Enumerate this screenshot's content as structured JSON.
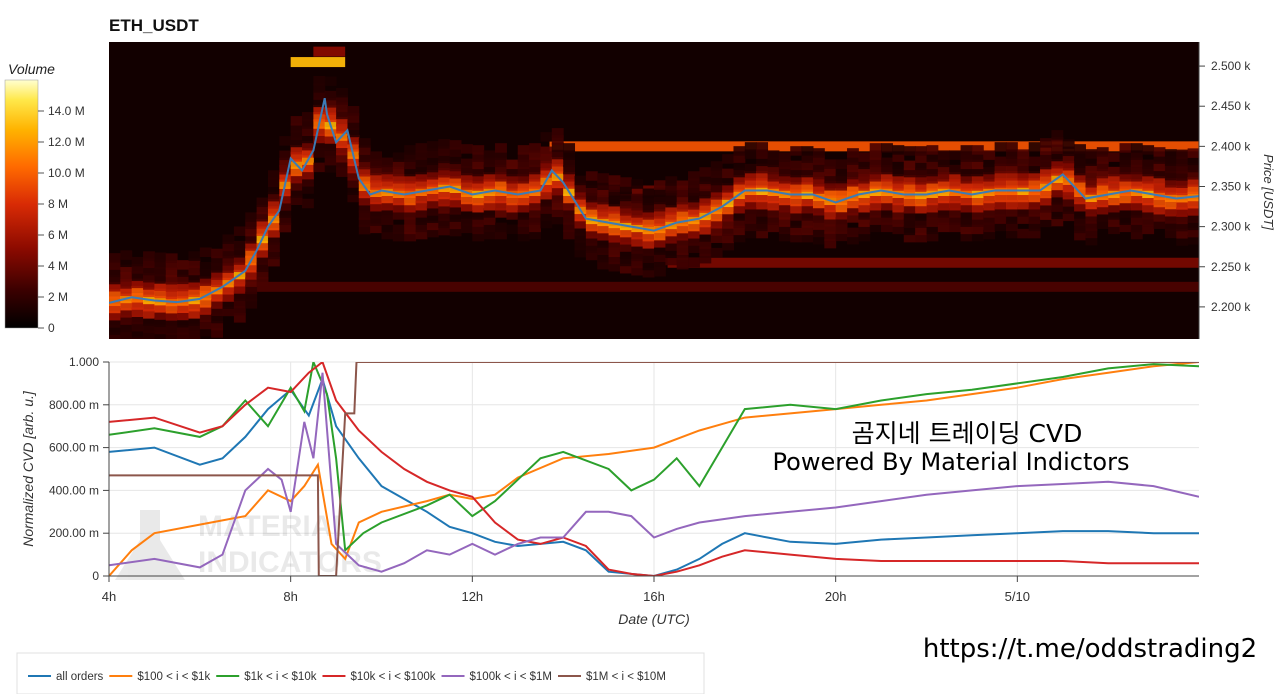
{
  "chart_data": [
    {
      "type": "heatmap",
      "title": "ETH_USDT",
      "ylabel": "Price [USDT]",
      "colorbar": {
        "label": "Volume",
        "ticks": [
          "0",
          "2 M",
          "4 M",
          "6 M",
          "8 M",
          "10.0 M",
          "12.0 M",
          "14.0 M"
        ],
        "range": [
          0,
          16
        ]
      },
      "yticks": [
        "2.200 k",
        "2.250 k",
        "2.300 k",
        "2.350 k",
        "2.400 k",
        "2.450 k",
        "2.500 k"
      ],
      "ylim": [
        2160,
        2530
      ],
      "xlim": [
        4,
        28
      ],
      "price_series": {
        "name": "",
        "x": [
          4,
          4.5,
          5,
          5.5,
          6,
          6.5,
          7,
          7.25,
          7.5,
          7.75,
          8,
          8.25,
          8.5,
          8.75,
          8.8,
          9,
          9.25,
          9.5,
          9.75,
          10,
          10.5,
          11,
          11.5,
          12,
          12.5,
          13,
          13.5,
          13.75,
          14,
          14.5,
          15,
          15.5,
          16,
          16.5,
          17,
          17.5,
          18,
          18.5,
          19,
          19.5,
          20,
          20.5,
          21,
          21.5,
          22,
          22.5,
          23,
          23.5,
          24,
          24.5,
          25,
          25.5,
          26,
          26.5,
          27,
          27.5,
          28
        ],
        "values": [
          2205,
          2212,
          2208,
          2206,
          2210,
          2225,
          2245,
          2270,
          2300,
          2320,
          2385,
          2370,
          2395,
          2460,
          2440,
          2405,
          2420,
          2360,
          2340,
          2345,
          2340,
          2345,
          2350,
          2340,
          2345,
          2340,
          2345,
          2370,
          2355,
          2310,
          2305,
          2300,
          2295,
          2305,
          2310,
          2325,
          2345,
          2345,
          2340,
          2340,
          2330,
          2340,
          2345,
          2340,
          2340,
          2345,
          2340,
          2345,
          2345,
          2345,
          2365,
          2335,
          2340,
          2345,
          2340,
          2335,
          2338
        ]
      },
      "bands": [
        {
          "price": 2400,
          "volume": 9.5,
          "x_start": 13.7,
          "x_end": 28
        },
        {
          "price": 2255,
          "volume": 4.5,
          "x_start": 16.3,
          "x_end": 28
        },
        {
          "price": 2345,
          "volume": 4,
          "x_start": 13,
          "x_end": 28
        },
        {
          "price": 2225,
          "volume": 3,
          "x_start": 4,
          "x_end": 28
        },
        {
          "price": 2505,
          "volume": 13,
          "x_start": 8,
          "x_end": 9.2
        },
        {
          "price": 2518,
          "volume": 5,
          "x_start": 8.5,
          "x_end": 9.2
        }
      ]
    },
    {
      "type": "line",
      "xlabel": "Date (UTC)",
      "ylabel": "Normalized CVD [arb. u.]",
      "xlim": [
        4,
        28
      ],
      "ylim": [
        0,
        1
      ],
      "xticks": [
        {
          "value": 4,
          "label": "4h"
        },
        {
          "value": 8,
          "label": "8h"
        },
        {
          "value": 12,
          "label": "12h"
        },
        {
          "value": 16,
          "label": "16h"
        },
        {
          "value": 20,
          "label": "20h"
        },
        {
          "value": 24,
          "label": "5/10"
        }
      ],
      "yticks": [
        {
          "value": 0,
          "label": "0"
        },
        {
          "value": 0.2,
          "label": "200.00 m"
        },
        {
          "value": 0.4,
          "label": "400.00 m"
        },
        {
          "value": 0.6,
          "label": "600.00 m"
        },
        {
          "value": 0.8,
          "label": "800.00 m"
        },
        {
          "value": 1,
          "label": "1.000"
        }
      ],
      "grid": true,
      "legend_position": "bottom",
      "series": [
        {
          "name": "all orders",
          "color": "#1f77b4",
          "x": [
            4,
            5,
            6,
            6.5,
            7,
            7.5,
            8,
            8.4,
            8.7,
            9,
            9.5,
            10,
            10.5,
            11,
            11.5,
            12,
            12.5,
            13,
            13.5,
            14,
            14.5,
            15,
            15.5,
            16,
            16.5,
            17,
            17.5,
            18,
            18.5,
            19,
            20,
            21,
            22,
            23,
            24,
            25,
            26,
            27,
            28
          ],
          "values": [
            0.58,
            0.6,
            0.52,
            0.55,
            0.65,
            0.78,
            0.87,
            0.75,
            0.92,
            0.7,
            0.55,
            0.42,
            0.36,
            0.3,
            0.23,
            0.2,
            0.16,
            0.14,
            0.15,
            0.16,
            0.12,
            0.02,
            0.01,
            0.0,
            0.03,
            0.08,
            0.15,
            0.2,
            0.18,
            0.16,
            0.15,
            0.17,
            0.18,
            0.19,
            0.2,
            0.21,
            0.21,
            0.2,
            0.2
          ]
        },
        {
          "name": "$100 < i < $1k",
          "color": "#ff7f0e",
          "x": [
            4,
            4.5,
            5,
            6,
            7,
            7.5,
            8,
            8.3,
            8.6,
            8.9,
            9.2,
            9.5,
            10,
            11,
            11.5,
            12,
            12.5,
            13,
            14,
            15,
            16,
            17,
            17.5,
            18,
            19,
            20,
            21,
            22,
            23,
            24,
            25,
            26,
            27,
            28
          ],
          "values": [
            0.0,
            0.12,
            0.2,
            0.24,
            0.28,
            0.4,
            0.35,
            0.42,
            0.52,
            0.15,
            0.08,
            0.25,
            0.3,
            0.35,
            0.38,
            0.36,
            0.38,
            0.46,
            0.55,
            0.57,
            0.6,
            0.68,
            0.71,
            0.74,
            0.76,
            0.78,
            0.8,
            0.82,
            0.85,
            0.88,
            0.92,
            0.95,
            0.98,
            1.0
          ]
        },
        {
          "name": "$1k < i < $10k",
          "color": "#2ca02c",
          "x": [
            4,
            5,
            6,
            6.5,
            7,
            7.5,
            8,
            8.3,
            8.5,
            8.8,
            9,
            9.2,
            9.6,
            10,
            11,
            11.5,
            12,
            12.5,
            13,
            13.5,
            14,
            15,
            15.5,
            16,
            16.5,
            17,
            17.5,
            18,
            19,
            20,
            21,
            22,
            23,
            24,
            25,
            26,
            27,
            28
          ],
          "values": [
            0.66,
            0.69,
            0.65,
            0.7,
            0.82,
            0.7,
            0.88,
            0.77,
            1.0,
            0.85,
            0.55,
            0.12,
            0.2,
            0.25,
            0.33,
            0.38,
            0.28,
            0.35,
            0.45,
            0.55,
            0.58,
            0.5,
            0.4,
            0.45,
            0.55,
            0.42,
            0.6,
            0.78,
            0.8,
            0.78,
            0.82,
            0.85,
            0.87,
            0.9,
            0.93,
            0.97,
            0.99,
            0.98
          ]
        },
        {
          "name": "$10k < i < $100k",
          "color": "#d62728",
          "x": [
            4,
            5,
            6,
            6.5,
            7,
            7.5,
            8,
            8.4,
            8.7,
            9,
            9.5,
            10,
            10.5,
            11,
            11.5,
            12,
            12.5,
            13,
            13.5,
            14,
            14.5,
            15,
            15.5,
            16,
            16.5,
            17,
            17.5,
            18,
            19,
            20,
            21,
            22,
            23,
            24,
            25,
            26,
            27,
            28
          ],
          "values": [
            0.72,
            0.74,
            0.67,
            0.7,
            0.8,
            0.88,
            0.86,
            0.95,
            1.0,
            0.82,
            0.68,
            0.58,
            0.5,
            0.44,
            0.4,
            0.37,
            0.25,
            0.17,
            0.15,
            0.18,
            0.14,
            0.03,
            0.01,
            0.0,
            0.02,
            0.05,
            0.09,
            0.12,
            0.1,
            0.08,
            0.07,
            0.07,
            0.07,
            0.07,
            0.07,
            0.06,
            0.06,
            0.06
          ]
        },
        {
          "name": "$100k < i < $1M",
          "color": "#9467bd",
          "x": [
            4,
            5,
            6,
            6.5,
            7,
            7.5,
            7.8,
            8,
            8.3,
            8.5,
            8.7,
            9,
            9.5,
            10,
            10.5,
            11,
            11.5,
            12,
            12.5,
            13,
            13.5,
            14,
            14.5,
            15,
            15.5,
            16,
            16.5,
            17,
            18,
            19,
            20,
            21,
            22,
            23,
            24,
            25,
            26,
            27,
            28
          ],
          "values": [
            0.05,
            0.08,
            0.04,
            0.1,
            0.4,
            0.5,
            0.45,
            0.3,
            0.72,
            0.55,
            0.95,
            0.15,
            0.05,
            0.02,
            0.06,
            0.12,
            0.1,
            0.15,
            0.1,
            0.15,
            0.18,
            0.18,
            0.3,
            0.3,
            0.28,
            0.18,
            0.22,
            0.25,
            0.28,
            0.3,
            0.32,
            0.35,
            0.38,
            0.4,
            0.42,
            0.43,
            0.44,
            0.42,
            0.37
          ]
        },
        {
          "name": "$1M < i < $10M",
          "color": "#8c564b",
          "x": [
            4,
            8.6,
            8.62,
            8.8,
            9,
            9.2,
            9.25,
            9.4,
            9.45,
            9.6,
            9.65,
            28
          ],
          "values": [
            0.47,
            0.47,
            0.0,
            0.0,
            0.0,
            0.76,
            0.76,
            0.76,
            1.0,
            1.0,
            1.0,
            1.0
          ]
        }
      ]
    }
  ],
  "overlay": {
    "line1": "곰지네 트레이딩 CVD",
    "line2": "Powered By Material Indictors",
    "url": "https://t.me/oddstrading2",
    "watermark_line1": "MATERIAL",
    "watermark_line2": "INDICATORS"
  },
  "colors": {
    "heatmap_bg": "#120000",
    "price_line": "#3c7bb6",
    "band_highlight": "#e82a18",
    "grid": "#e6e6e6",
    "axis": "#444444"
  }
}
